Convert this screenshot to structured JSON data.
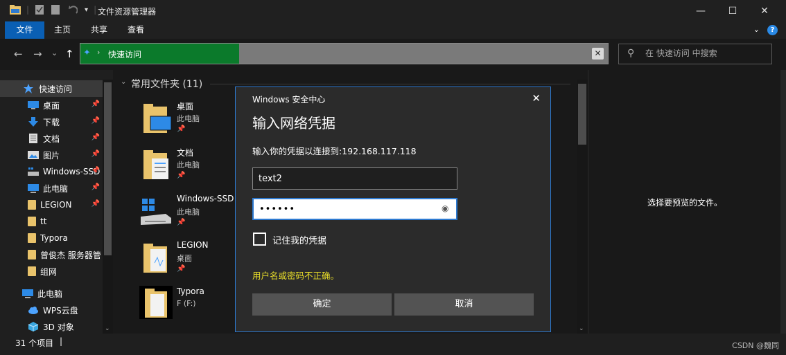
{
  "window": {
    "title": "文件资源管理器",
    "minimize": "—",
    "maximize": "☐",
    "close": "✕"
  },
  "ribbon": {
    "tabs": [
      "文件",
      "主页",
      "共享",
      "查看"
    ],
    "active_tab": "文件",
    "help": "?"
  },
  "nav": {
    "back": "←",
    "forward": "→",
    "recent": "⌄",
    "up": "↑",
    "breadcrumb": "快速访问",
    "search_placeholder": "在 快速访问 中搜索"
  },
  "sidebar": {
    "items": [
      {
        "label": "快速访问",
        "icon": "quick-access-star-icon"
      },
      {
        "label": "桌面",
        "icon": "desktop-icon",
        "pinned": true
      },
      {
        "label": "下载",
        "icon": "download-icon",
        "pinned": true
      },
      {
        "label": "文档",
        "icon": "documents-icon",
        "pinned": true
      },
      {
        "label": "图片",
        "icon": "pictures-icon",
        "pinned": true
      },
      {
        "label": "Windows-SSD",
        "icon": "drive-icon",
        "pinned": true
      },
      {
        "label": "此电脑",
        "icon": "computer-icon",
        "pinned": true
      },
      {
        "label": "LEGION",
        "icon": "folder-icon",
        "pinned": true
      },
      {
        "label": "tt",
        "icon": "folder-icon"
      },
      {
        "label": "Typora",
        "icon": "folder-icon"
      },
      {
        "label": "曾俊杰 服务器管",
        "icon": "folder-icon"
      },
      {
        "label": "组网",
        "icon": "folder-icon"
      },
      {
        "label": "此电脑",
        "icon": "computer-icon"
      },
      {
        "label": "WPS云盘",
        "icon": "cloud-icon"
      },
      {
        "label": "3D 对象",
        "icon": "3d-objects-icon"
      }
    ]
  },
  "content": {
    "group_header": "常用文件夹 (11)",
    "tiles": [
      {
        "name": "桌面",
        "sub": "此电脑"
      },
      {
        "name": "文档",
        "sub": "此电脑"
      },
      {
        "name": "Windows-SSD",
        "sub": "此电脑"
      },
      {
        "name": "LEGION",
        "sub": "桌面"
      },
      {
        "name": "Typora",
        "sub": "F (F:)"
      }
    ]
  },
  "preview": {
    "message": "选择要预览的文件。"
  },
  "status": {
    "count": "31 个项目",
    "watermark": "CSDN @魏同"
  },
  "dialog": {
    "title": "Windows 安全中心",
    "heading": "输入网络凭据",
    "prompt": "输入你的凭据以连接到:192.168.117.118",
    "username": "text2",
    "password": "••••••",
    "remember_label": "记住我的凭据",
    "remember_checked": false,
    "error": "用户名或密码不正确。",
    "ok_label": "确定",
    "cancel_label": "取消"
  },
  "colors": {
    "accent": "#0a5fb4",
    "address_green": "#0b7a2b",
    "dialog_border": "#2d7ad1",
    "error": "#e9de29"
  }
}
